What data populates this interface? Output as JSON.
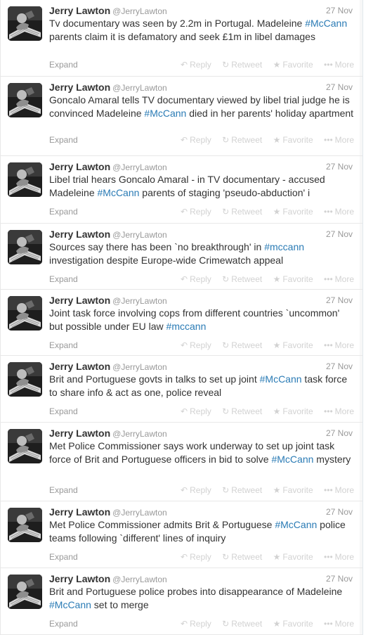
{
  "colors": {
    "hashtag": "#2a7bb5",
    "muted": "#999999",
    "faded_action": "#d2d2d2"
  },
  "actions": {
    "expand": "Expand",
    "reply": "Reply",
    "retweet": "Retweet",
    "favorite": "Favorite",
    "more": "More"
  },
  "icons": {
    "reply": "reply-arrow-icon",
    "retweet": "retweet-icon",
    "favorite": "star-icon",
    "more": "dots-icon"
  },
  "tweets": [
    {
      "name": "Jerry Lawton",
      "handle": "@JerryLawton",
      "time": "27 Nov",
      "segments": [
        {
          "t": "Tv documentary was seen by 2.2m in Portugal. Madeleine "
        },
        {
          "t": "#McCann",
          "tag": true
        },
        {
          "t": " parents claim it is defamatory and seek £1m in libel damages"
        }
      ]
    },
    {
      "name": "Jerry Lawton",
      "handle": "@JerryLawton",
      "time": "27 Nov",
      "segments": [
        {
          "t": "Goncalo Amaral tells TV documentary viewed by libel trial judge he is convinced Madeleine "
        },
        {
          "t": "#McCann",
          "tag": true
        },
        {
          "t": " died in her parents' holiday apartment"
        }
      ]
    },
    {
      "name": "Jerry Lawton",
      "handle": "@JerryLawton",
      "time": "27 Nov",
      "segments": [
        {
          "t": "Libel trial hears Goncalo Amaral - in TV documentary - accused Madeleine "
        },
        {
          "t": "#McCann",
          "tag": true
        },
        {
          "t": " parents of staging 'pseudo-abduction' i"
        }
      ]
    },
    {
      "name": "Jerry Lawton",
      "handle": "@JerryLawton",
      "time": "27 Nov",
      "segments": [
        {
          "t": "Sources say there has been `no breakthrough' in "
        },
        {
          "t": "#mccann",
          "tag": true
        },
        {
          "t": " investigation despite Europe-wide Crimewatch appeal"
        }
      ]
    },
    {
      "name": "Jerry Lawton",
      "handle": "@JerryLawton",
      "time": "27 Nov",
      "segments": [
        {
          "t": "Joint task force involving cops from different countries `uncommon' but possible under EU law "
        },
        {
          "t": "#mccann",
          "tag": true
        }
      ]
    },
    {
      "name": "Jerry Lawton",
      "handle": "@JerryLawton",
      "time": "27 Nov",
      "segments": [
        {
          "t": "Brit and Portuguese govts in talks to set up joint "
        },
        {
          "t": "#McCann",
          "tag": true
        },
        {
          "t": " task force to share info & act as one, police reveal"
        }
      ]
    },
    {
      "name": "Jerry Lawton",
      "handle": "@JerryLawton",
      "time": "27 Nov",
      "segments": [
        {
          "t": "Met Police Commissioner says work underway to set up joint task force of Brit and Portuguese officers in bid to solve "
        },
        {
          "t": "#McCann",
          "tag": true
        },
        {
          "t": " mystery"
        }
      ]
    },
    {
      "name": "Jerry Lawton",
      "handle": "@JerryLawton",
      "time": "27 Nov",
      "segments": [
        {
          "t": "Met Police Commissioner admits Brit & Portuguese "
        },
        {
          "t": "#McCann",
          "tag": true
        },
        {
          "t": " police teams following `different' lines of inquiry"
        }
      ]
    },
    {
      "name": "Jerry Lawton",
      "handle": "@JerryLawton",
      "time": "27 Nov",
      "segments": [
        {
          "t": "Brit and Portuguese police probes into disappearance of Madeleine "
        },
        {
          "t": "#McCann",
          "tag": true
        },
        {
          "t": " set to merge"
        }
      ]
    }
  ]
}
